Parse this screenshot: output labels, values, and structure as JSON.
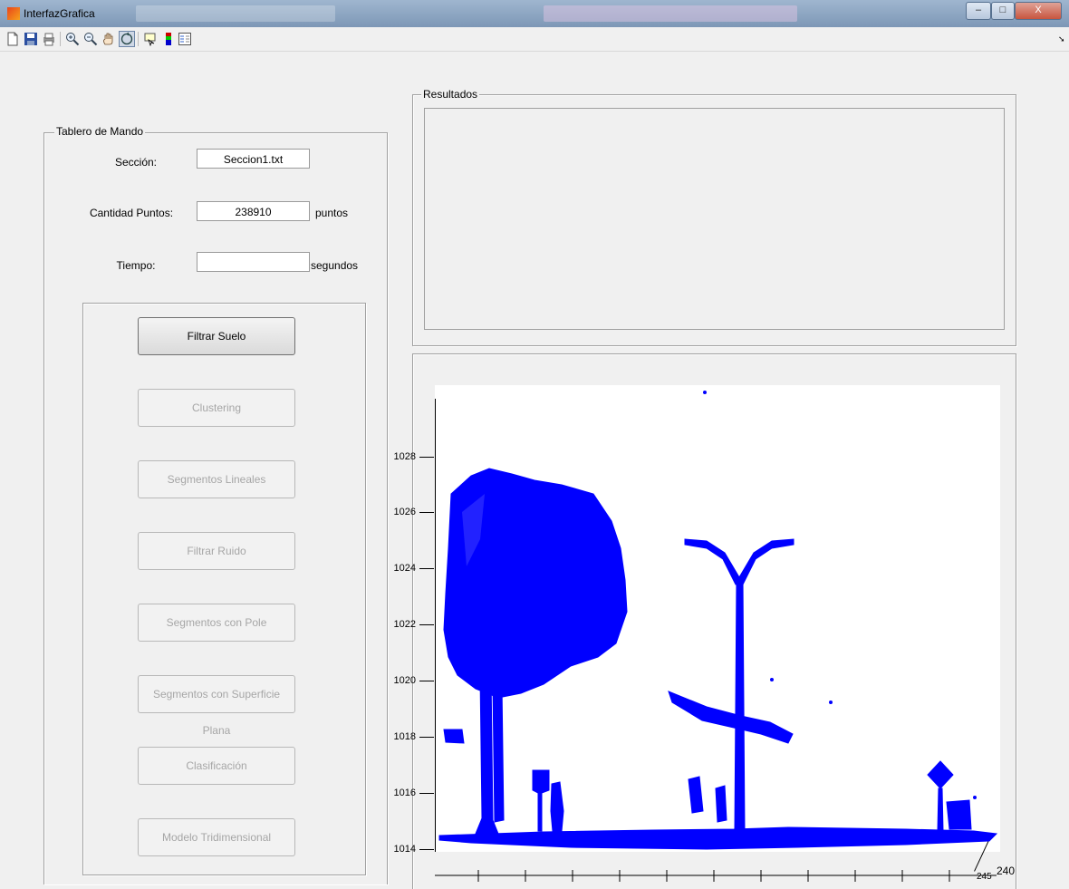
{
  "window": {
    "title": "InterfazGrafica",
    "controls": [
      "–",
      "□",
      "X"
    ]
  },
  "toolbar": {
    "icons": [
      "new-file-icon",
      "open-folder-icon",
      "save-icon",
      "print-icon",
      "zoom-in-icon",
      "zoom-out-icon",
      "pan-hand-icon",
      "rotate-3d-icon",
      "data-cursor-icon",
      "colorbar-icon",
      "legend-icon"
    ]
  },
  "tablero": {
    "title": "Tablero de Mando",
    "seccion_label": "Sección:",
    "seccion_value": "Seccion1.txt",
    "cantidad_label": "Cantidad Puntos:",
    "cantidad_value": "238910",
    "cantidad_unit": "puntos",
    "tiempo_label": "Tiempo:",
    "tiempo_value": "",
    "tiempo_unit": "segundos",
    "buttons": [
      {
        "label": "Filtrar Suelo",
        "enabled": true
      },
      {
        "label": "Clustering",
        "enabled": false
      },
      {
        "label": "Segmentos Lineales",
        "enabled": false
      },
      {
        "label": "Filtrar Ruido",
        "enabled": false
      },
      {
        "label": "Segmentos con Pole",
        "enabled": false
      },
      {
        "label": "Segmentos con Superficie Plana",
        "enabled": false
      },
      {
        "label": "Clasificación",
        "enabled": false
      },
      {
        "label": "Modelo Tridimensional",
        "enabled": false
      }
    ]
  },
  "resultados": {
    "title": "Resultados"
  },
  "plot": {
    "yticks": [
      "1028",
      "1026",
      "1024",
      "1022",
      "1020",
      "1018",
      "1016",
      "1014"
    ],
    "depth_ticks": [
      "240",
      "245"
    ],
    "point_color": "#0000ff"
  },
  "colors": {
    "bg": "#f0f0f0",
    "points": "#0000ff",
    "titlebar": "#8aa4c2"
  }
}
